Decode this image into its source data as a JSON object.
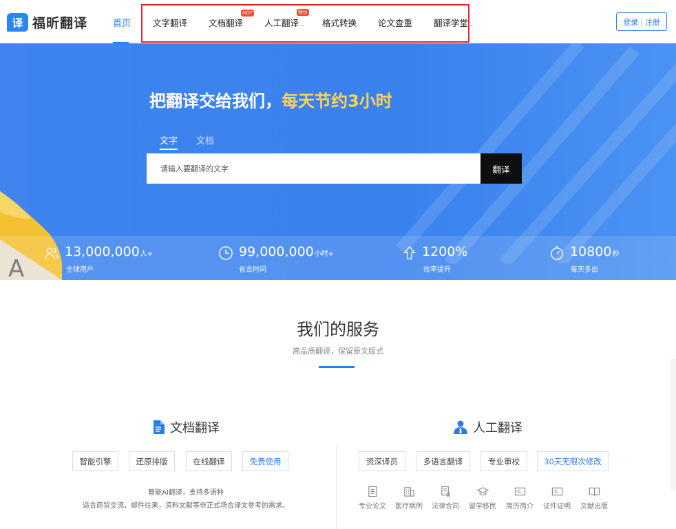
{
  "brand": {
    "logo_char": "译",
    "name": "福昕翻译"
  },
  "nav": {
    "home": "首页",
    "items": [
      {
        "label": "文字翻译"
      },
      {
        "label": "文档翻译",
        "badge": "HOT"
      },
      {
        "label": "人工翻译",
        "badge": "特价",
        "caret": "⌄"
      },
      {
        "label": "格式转换"
      },
      {
        "label": "论文查重"
      },
      {
        "label": "翻译学堂",
        "caret": "⌄"
      }
    ],
    "login": "登录",
    "register": "注册",
    "separator": "|"
  },
  "hero": {
    "title_main": "把翻译交给我们，",
    "title_highlight": "每天节约3小时",
    "tabs": [
      "文字",
      "文档"
    ],
    "search_placeholder": "请输入要翻译的文字",
    "translate_button": "翻译"
  },
  "stats": [
    {
      "icon": "users-icon",
      "value": "13,000,000",
      "unit": "人+",
      "label": "全球用户"
    },
    {
      "icon": "clock-icon",
      "value": "99,000,000",
      "unit": "小时+",
      "label": "省去时间"
    },
    {
      "icon": "arrow-up-icon",
      "value": "1200%",
      "unit": "",
      "label": "效率提升"
    },
    {
      "icon": "timer-icon",
      "value": "10800",
      "unit": "秒",
      "label": "每天多出"
    }
  ],
  "corner_art": {
    "letter": "A"
  },
  "services": {
    "title": "我们的服务",
    "subtitle": "高品质翻译，保留原文版式",
    "doc": {
      "title": "文档翻译",
      "tags": [
        "智能引擎",
        "还原排版",
        "在线翻译",
        "免费使用"
      ],
      "desc_line1": "智能AI翻译，支持多语种",
      "desc_line2": "适合商贸交流，邮件往来，资料文献等非正式场合译文参考的需求。"
    },
    "human": {
      "title": "人工翻译",
      "tags": [
        "资深译员",
        "多语言翻译",
        "专业审校",
        "30天无限次修改"
      ],
      "categories": [
        "专业论文",
        "医疗病例",
        "法律合同",
        "留学移民",
        "简历简介",
        "证件证明",
        "文献出版"
      ]
    }
  },
  "colors": {
    "primary": "#2b7de9",
    "hero_bg": "#3f84ef",
    "highlight": "#ffd44a",
    "nav_box": "#e8232a"
  }
}
